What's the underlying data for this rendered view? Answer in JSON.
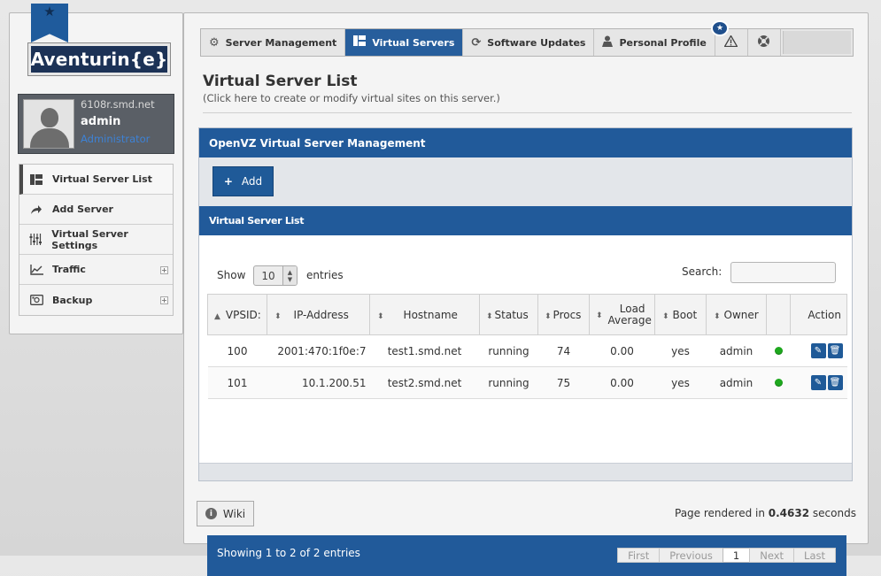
{
  "brand": {
    "logo_text": "Aventurin{e}",
    "ribbon_icon": "star-icon"
  },
  "user": {
    "host": "6108r.smd.net",
    "name": "admin",
    "role": "Administrator"
  },
  "sidebar": {
    "items": [
      {
        "label": "Virtual Server List",
        "icon": "list-icon",
        "active": true
      },
      {
        "label": "Add Server",
        "icon": "share-arrow-icon"
      },
      {
        "label": "Virtual Server Settings",
        "icon": "sliders-icon"
      },
      {
        "label": "Traffic",
        "icon": "chart-icon",
        "expand": "+"
      },
      {
        "label": "Backup",
        "icon": "hdd-icon",
        "expand": "+"
      }
    ]
  },
  "tabs": [
    {
      "label": "Server Management",
      "icon": "gear-icon"
    },
    {
      "label": "Virtual Servers",
      "icon": "list-icon",
      "active": true
    },
    {
      "label": "Software Updates",
      "icon": "refresh-icon"
    },
    {
      "label": "Personal Profile",
      "icon": "user-icon"
    }
  ],
  "tab_icons": {
    "alert": "alert-icon",
    "support": "lifebuoy-icon"
  },
  "page": {
    "title": "Virtual Server List",
    "subtitle": "(Click here to create or modify virtual sites on this server.)"
  },
  "box": {
    "title": "OpenVZ Virtual Server Management",
    "add_label": "Add",
    "list_title": "Virtual Server List"
  },
  "table_controls": {
    "show_label": "Show",
    "page_size": "10",
    "entries_label": "entries",
    "search_label": "Search:"
  },
  "table": {
    "columns": [
      "VPSID:",
      "IP-Address",
      "Hostname",
      "Status",
      "Procs",
      "Load Average",
      "Boot",
      "Owner",
      "",
      "Action"
    ],
    "rows": [
      {
        "vpsid": "100",
        "ip": "2001:470:1f0e:7",
        "hostname": "test1.smd.net",
        "status": "running",
        "procs": "74",
        "load": "0.00",
        "boot": "yes",
        "owner": "admin"
      },
      {
        "vpsid": "101",
        "ip": "10.1.200.51",
        "hostname": "test2.smd.net",
        "status": "running",
        "procs": "75",
        "load": "0.00",
        "boot": "yes",
        "owner": "admin"
      }
    ]
  },
  "table_footer": {
    "info": "Showing 1 to 2 of 2 entries",
    "pager": [
      "First",
      "Previous",
      "1",
      "Next",
      "Last"
    ],
    "current_page": "1"
  },
  "footer": {
    "wiki_label": "Wiki",
    "render_prefix": "Page rendered in ",
    "render_time": "0.4632",
    "render_suffix": " seconds"
  },
  "colors": {
    "primary": "#215a9a",
    "status_ok": "#1ea81e"
  }
}
